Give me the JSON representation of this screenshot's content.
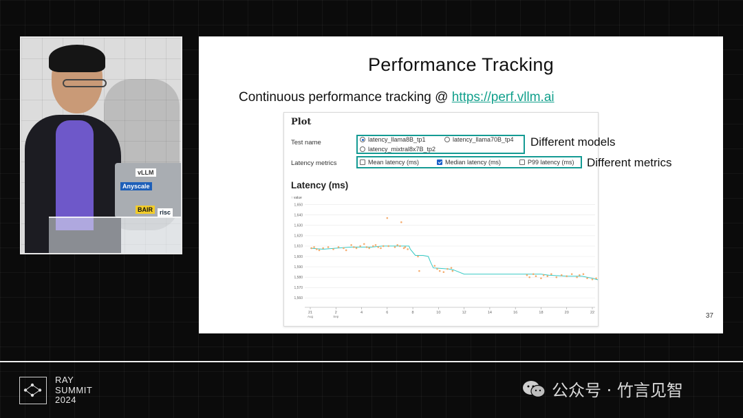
{
  "slide": {
    "title": "Performance Tracking",
    "subtitle_prefix": "Continuous performance tracking @ ",
    "subtitle_link": "https://perf.vllm.ai",
    "page_number": "37"
  },
  "panel": {
    "title": "Plot",
    "test_name_label": "Test name",
    "test_options": [
      {
        "label": "latency_llama8B_tp1",
        "selected": true
      },
      {
        "label": "latency_llama70B_tp4",
        "selected": false
      },
      {
        "label": "latency_mixtral8x7B_tp2",
        "selected": false
      }
    ],
    "metrics_label": "Latency metrics",
    "metric_options": [
      {
        "label": "Mean latency (ms)",
        "checked": false
      },
      {
        "label": "Median latency (ms)",
        "checked": true
      },
      {
        "label": "P99 latency (ms)",
        "checked": false
      }
    ],
    "chart_title": "Latency (ms)"
  },
  "annotations": {
    "models": "Different models",
    "metrics": "Different metrics"
  },
  "chart_data": {
    "type": "line",
    "title": "Latency (ms)",
    "ylabel": "↑ value",
    "ylim": [
      1555,
      1653
    ],
    "yticks": [
      1560,
      1570,
      1580,
      1590,
      1600,
      1610,
      1620,
      1630,
      1640,
      1650
    ],
    "x_ticks": [
      "21",
      "2",
      "4",
      "6",
      "8",
      "10",
      "12",
      "14",
      "16",
      "18",
      "20",
      "22"
    ],
    "x_tick_sublabels": [
      "Aug",
      "Sep",
      "",
      "",
      "",
      "",
      "",
      "",
      "",
      "",
      "",
      ""
    ],
    "line_color": "#35c9c4",
    "point_color": "#f4a460",
    "line": [
      [
        0.0,
        1608
      ],
      [
        0.5,
        1607
      ],
      [
        1.0,
        1608
      ],
      [
        1.6,
        1609
      ],
      [
        2.0,
        1609
      ],
      [
        2.4,
        1609
      ],
      [
        2.8,
        1610
      ],
      [
        3.2,
        1610
      ],
      [
        3.6,
        1610
      ],
      [
        3.85,
        1610
      ],
      [
        3.9,
        1607
      ],
      [
        4.0,
        1604
      ],
      [
        4.1,
        1601
      ],
      [
        4.4,
        1601
      ],
      [
        4.6,
        1600
      ],
      [
        4.7,
        1594
      ],
      [
        4.8,
        1589
      ],
      [
        5.4,
        1588
      ],
      [
        5.6,
        1587
      ],
      [
        6.0,
        1583
      ],
      [
        9.0,
        1583
      ],
      [
        9.3,
        1582
      ],
      [
        10.0,
        1581
      ],
      [
        10.6,
        1581
      ],
      [
        11.0,
        1579
      ],
      [
        11.3,
        1577
      ]
    ],
    "points": [
      [
        0.05,
        1608
      ],
      [
        0.15,
        1609
      ],
      [
        0.25,
        1607
      ],
      [
        0.35,
        1606
      ],
      [
        0.5,
        1608
      ],
      [
        0.7,
        1609
      ],
      [
        0.9,
        1607
      ],
      [
        1.1,
        1609
      ],
      [
        1.3,
        1608
      ],
      [
        1.4,
        1606
      ],
      [
        1.6,
        1611
      ],
      [
        1.7,
        1609
      ],
      [
        1.8,
        1608
      ],
      [
        1.95,
        1610
      ],
      [
        2.1,
        1612
      ],
      [
        2.2,
        1609
      ],
      [
        2.3,
        1608
      ],
      [
        2.45,
        1610
      ],
      [
        2.55,
        1611
      ],
      [
        2.65,
        1609
      ],
      [
        2.75,
        1608
      ],
      [
        2.85,
        1610
      ],
      [
        3.0,
        1637
      ],
      [
        3.05,
        1610
      ],
      [
        3.3,
        1609
      ],
      [
        3.4,
        1611
      ],
      [
        3.5,
        1610
      ],
      [
        3.55,
        1633
      ],
      [
        3.65,
        1608
      ],
      [
        3.7,
        1609
      ],
      [
        3.8,
        1607
      ],
      [
        4.2,
        1600
      ],
      [
        4.25,
        1586
      ],
      [
        4.85,
        1591
      ],
      [
        4.95,
        1588
      ],
      [
        5.05,
        1586
      ],
      [
        5.2,
        1585
      ],
      [
        5.35,
        1588
      ],
      [
        5.5,
        1589
      ],
      [
        5.55,
        1586
      ],
      [
        8.45,
        1582
      ],
      [
        8.55,
        1580
      ],
      [
        8.7,
        1583
      ],
      [
        8.8,
        1581
      ],
      [
        9.0,
        1579
      ],
      [
        9.1,
        1582
      ],
      [
        9.25,
        1581
      ],
      [
        9.4,
        1583
      ],
      [
        9.6,
        1580
      ],
      [
        9.8,
        1582
      ],
      [
        10.0,
        1581
      ],
      [
        10.2,
        1583
      ],
      [
        10.4,
        1580
      ],
      [
        10.5,
        1582
      ],
      [
        10.65,
        1583
      ],
      [
        10.8,
        1579
      ],
      [
        11.0,
        1578
      ],
      [
        11.15,
        1579
      ]
    ]
  },
  "video": {
    "stickers": [
      "vLLM",
      "Anyscale",
      "BAIR",
      "risc"
    ]
  },
  "footer": {
    "logo_lines": [
      "RAY",
      "SUMMIT",
      "2024"
    ],
    "watermark": "公众号 · 竹言见智"
  }
}
